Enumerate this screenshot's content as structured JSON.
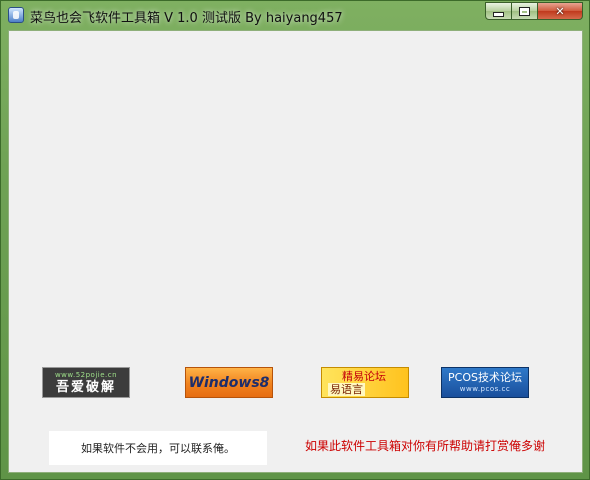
{
  "window": {
    "title": "菜鸟也会飞软件工具箱 V 1.0 测试版   By haiyang457",
    "controls": {
      "minimize": "minimize",
      "maximize": "maximize",
      "close": "✕"
    }
  },
  "banners": {
    "pojie": {
      "sub": "www.52pojie.cn",
      "main": "吾爱破解"
    },
    "win8": {
      "label": "Windows8"
    },
    "jingyi": {
      "line1": "精易论坛",
      "line2": "易语言"
    },
    "pcos": {
      "line1": "PCOS技术论坛",
      "line2": "www.pcos.cc"
    }
  },
  "footer": {
    "note": "如果软件不会用，可以联系俺。",
    "donate": "如果此软件工具箱对你有所帮助请打赏俺多谢"
  },
  "colors": {
    "frame": "#6fa255",
    "client": "#f0f0f0",
    "donate_text": "#cc0000"
  }
}
